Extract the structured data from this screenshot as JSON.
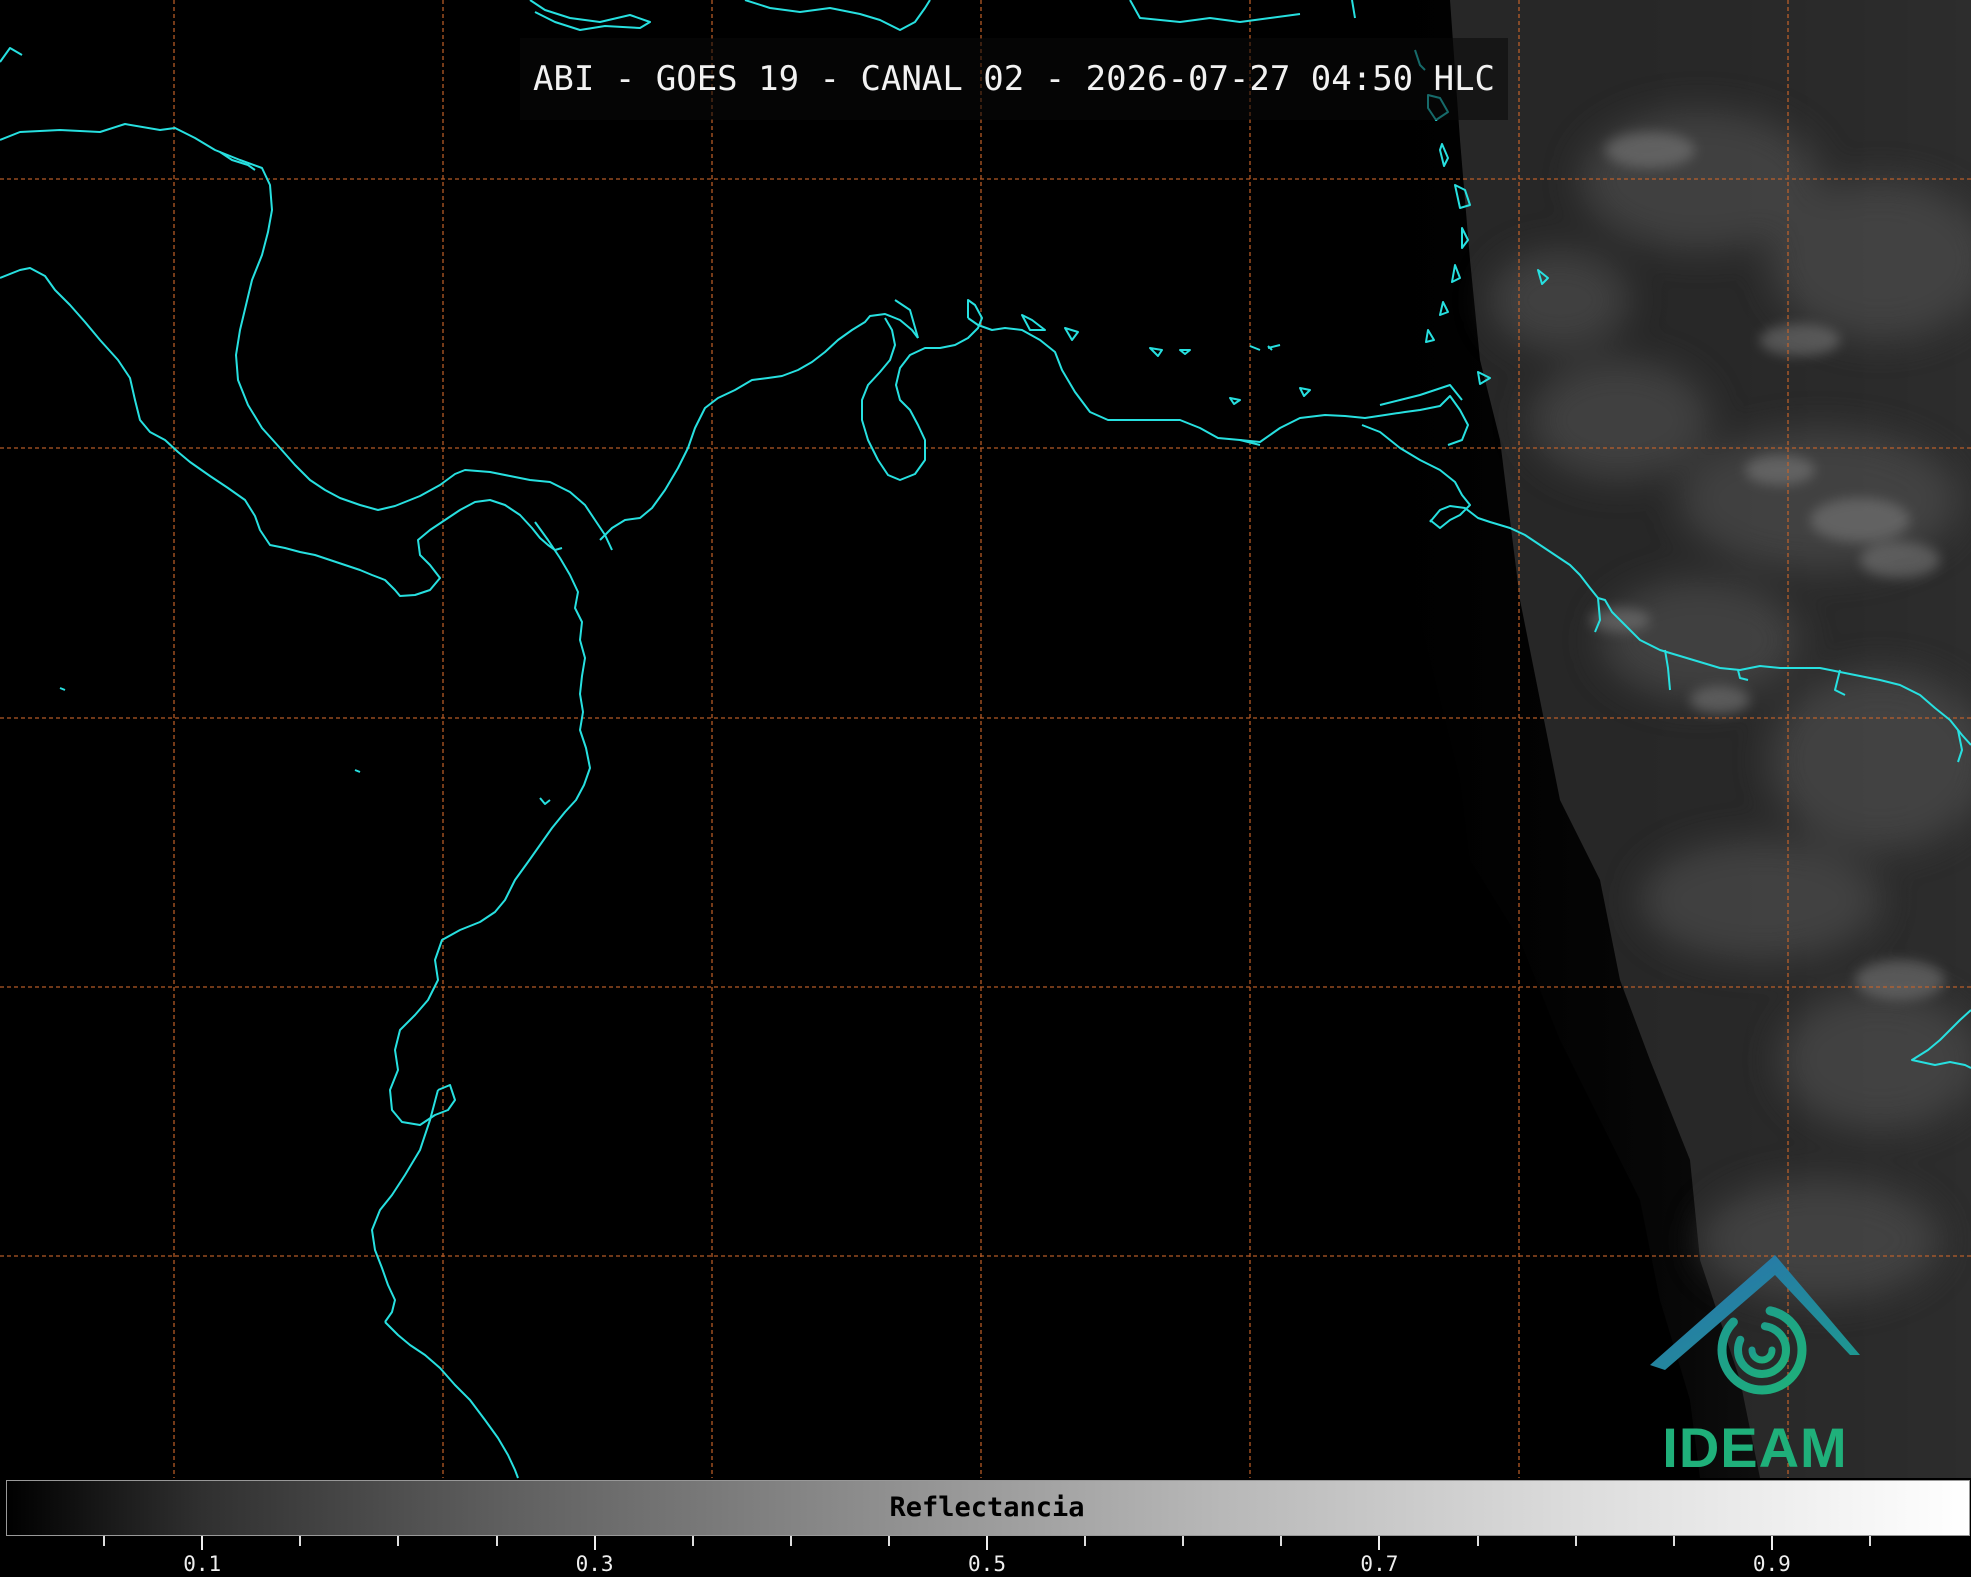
{
  "header": {
    "title": "ABI - GOES 19 - CANAL 02 - 2026-07-27 04:50 HLC"
  },
  "map": {
    "coastline_color": "#27e0e0",
    "gridline_color": "#c8642a",
    "background_color": "#000000",
    "grid_style": "dashed"
  },
  "colorbar": {
    "label": "Reflectancia",
    "tick_labels": [
      "0.1",
      "0.3",
      "0.5",
      "0.7",
      "0.9"
    ],
    "tick_values": [
      0.1,
      0.3,
      0.5,
      0.7,
      0.9
    ],
    "range": [
      0,
      1
    ],
    "colormap": "grayscale"
  },
  "logo": {
    "text": "IDEAM",
    "text_color": "#1fb07a",
    "roof_color": "#2a6fb0"
  }
}
